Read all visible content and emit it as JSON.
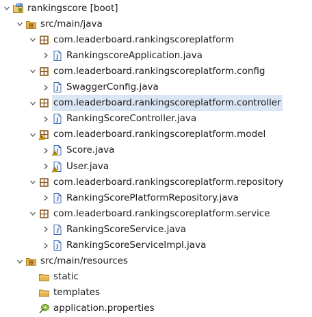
{
  "tree": {
    "items": [
      {
        "label": "rankingscore [boot]",
        "icon": "java-project-icon",
        "expanded": true,
        "depth": 0
      },
      {
        "label": "src/main/java",
        "icon": "source-folder-icon",
        "expanded": true,
        "depth": 1
      },
      {
        "label": "com.leaderboard.rankingscoreplatform",
        "icon": "package-icon",
        "expanded": true,
        "depth": 2
      },
      {
        "label": "RankingscoreApplication.java",
        "icon": "java-file-icon",
        "expanded": false,
        "depth": 3
      },
      {
        "label": "com.leaderboard.rankingscoreplatform.config",
        "icon": "package-icon",
        "expanded": true,
        "depth": 2
      },
      {
        "label": "SwaggerConfig.java",
        "icon": "java-file-icon",
        "expanded": false,
        "depth": 3
      },
      {
        "label": "com.leaderboard.rankingscoreplatform.controller",
        "icon": "package-icon",
        "expanded": true,
        "depth": 2
      },
      {
        "label": "RankingScoreController.java",
        "icon": "java-file-icon",
        "expanded": false,
        "depth": 3
      },
      {
        "label": "com.leaderboard.rankingscoreplatform.model",
        "icon": "package-warning-icon",
        "expanded": true,
        "depth": 2
      },
      {
        "label": "Score.java",
        "icon": "java-file-warning-icon",
        "expanded": false,
        "depth": 3
      },
      {
        "label": "User.java",
        "icon": "java-file-warning-icon",
        "expanded": false,
        "depth": 3
      },
      {
        "label": "com.leaderboard.rankingscoreplatform.repository",
        "icon": "package-icon",
        "expanded": true,
        "depth": 2
      },
      {
        "label": "RankingScorePlatformRepository.java",
        "icon": "java-interface-icon",
        "expanded": false,
        "depth": 3
      },
      {
        "label": "com.leaderboard.rankingscoreplatform.service",
        "icon": "package-icon",
        "expanded": true,
        "depth": 2
      },
      {
        "label": "RankingScoreService.java",
        "icon": "java-interface-icon",
        "expanded": false,
        "depth": 3
      },
      {
        "label": "RankingScoreServiceImpl.java",
        "icon": "java-file-icon",
        "expanded": false,
        "depth": 3
      },
      {
        "label": "src/main/resources",
        "icon": "source-folder-icon",
        "expanded": true,
        "depth": 1
      },
      {
        "label": "static",
        "icon": "folder-icon",
        "expanded": null,
        "depth": 2
      },
      {
        "label": "templates",
        "icon": "folder-icon",
        "expanded": null,
        "depth": 2
      },
      {
        "label": "application.properties",
        "icon": "properties-file-icon",
        "expanded": null,
        "depth": 2
      }
    ]
  },
  "selected_label": "com.leaderboard.rankingscoreplatform.controller",
  "colors": {
    "selection": "#dae6f4",
    "package": "#8c5a1e",
    "folder": "#e8b54a",
    "java_file": "#3c6db0",
    "warning": "#e0a800",
    "properties": "#6a9e2b"
  }
}
